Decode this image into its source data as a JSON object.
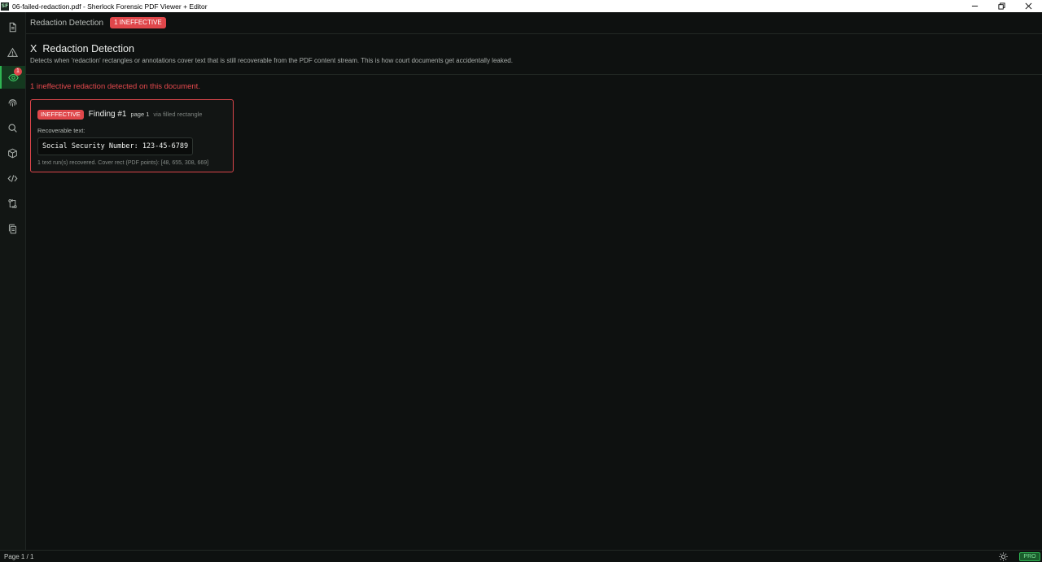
{
  "window": {
    "app_icon_text": "SF",
    "title": "06-failed-redaction.pdf - Sherlock Forensic PDF Viewer + Editor"
  },
  "sidebar": {
    "items": [
      {
        "icon": "document-icon"
      },
      {
        "icon": "warning-icon"
      },
      {
        "icon": "eye-icon",
        "badge": "1",
        "active": true
      },
      {
        "icon": "fingerprint-icon"
      },
      {
        "icon": "search-icon"
      },
      {
        "icon": "cube-icon"
      },
      {
        "icon": "code-icon"
      },
      {
        "icon": "git-compare-icon"
      },
      {
        "icon": "copy-icon"
      }
    ]
  },
  "topbar": {
    "breadcrumb": "Redaction Detection",
    "badge": "1 INEFFECTIVE"
  },
  "header": {
    "icon_glyph": "X",
    "title": "Redaction Detection",
    "description": "Detects when 'redaction' rectangles or annotations cover text that is still recoverable from the PDF content stream. This is how court documents get accidentally leaked."
  },
  "summary": "1 ineffective redaction detected on this document.",
  "finding": {
    "badge": "INEFFECTIVE",
    "title": "Finding #1",
    "page": "page 1",
    "via": "via filled rectangle",
    "recoverable_label": "Recoverable text:",
    "recoverable_text": "Social Security Number: 123-45-6789",
    "footer": "1 text run(s) recovered. Cover rect (PDF points): [48, 655, 308, 669]"
  },
  "statusbar": {
    "page_indicator": "Page 1 / 1",
    "pro_label": "PRO"
  },
  "colors": {
    "accent_green": "#2fb552",
    "danger_red": "#e0474b",
    "background": "#0e1110"
  }
}
